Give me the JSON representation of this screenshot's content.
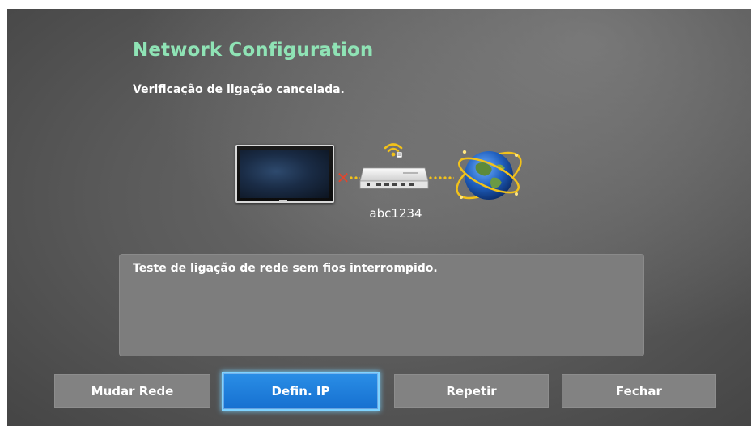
{
  "dialog": {
    "title": "Network Configuration",
    "status": "Verificação de ligação cancelada.",
    "message": "Teste de ligação de rede sem fios interrompido."
  },
  "diagram": {
    "tv_icon": "tv-icon",
    "link_status_icon": "x-icon",
    "router_icon": "router-icon",
    "wifi_icon": "wifi-icon",
    "globe_icon": "globe-icon",
    "network_name": "abc1234",
    "error_color": "#e0462e",
    "link_color": "#f2c21a"
  },
  "buttons": {
    "change_network": "Mudar Rede",
    "ip_settings": "Defin. IP",
    "retry": "Repetir",
    "close": "Fechar"
  },
  "colors": {
    "title": "#8fe3b5",
    "focus_button": "#1c7ad8"
  }
}
